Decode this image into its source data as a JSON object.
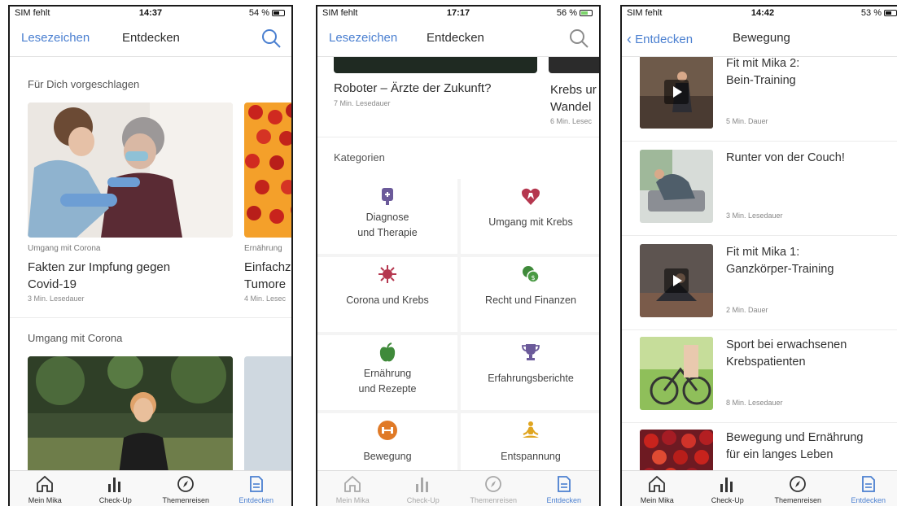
{
  "screen1": {
    "status": {
      "carrier": "SIM fehlt",
      "time": "14:37",
      "battery": "54 %"
    },
    "nav": {
      "left": "Lesezeichen",
      "title": "Entdecken"
    },
    "section1": "Für Dich vorgeschlagen",
    "card1": {
      "category": "Umgang mit Corona",
      "title": "Fakten zur Impfung gegen\nCovid-19",
      "meta": "3 Min. Lesedauer"
    },
    "card2": {
      "category": "Ernährung",
      "title": "Einfachz\nTumore",
      "meta": "4 Min. Lesec"
    },
    "section2": "Umgang mit Corona"
  },
  "screen2": {
    "status": {
      "carrier": "SIM fehlt",
      "time": "17:17",
      "battery": "56 %"
    },
    "nav": {
      "left": "Lesezeichen",
      "title": "Entdecken"
    },
    "card1": {
      "title": "Roboter – Ärzte der Zukunft?",
      "meta": "7 Min. Lesedauer"
    },
    "card2": {
      "title": "Krebs ur\nWandel",
      "meta": "6 Min. Lesec"
    },
    "categories_heading": "Kategorien",
    "categories": [
      {
        "label": "Diagnose\nund Therapie",
        "icon": "iv-bag-icon"
      },
      {
        "label": "Umgang mit Krebs",
        "icon": "ribbon-heart-icon"
      },
      {
        "label": "Corona und Krebs",
        "icon": "virus-icon"
      },
      {
        "label": "Recht und Finanzen",
        "icon": "coins-icon"
      },
      {
        "label": "Ernährung\nund Rezepte",
        "icon": "apple-icon"
      },
      {
        "label": "Erfahrungsberichte",
        "icon": "trophy-icon"
      },
      {
        "label": "Bewegung",
        "icon": "dumbbell-icon"
      },
      {
        "label": "Entspannung",
        "icon": "meditation-icon"
      }
    ]
  },
  "screen3": {
    "status": {
      "carrier": "SIM fehlt",
      "time": "14:42",
      "battery": "53 %"
    },
    "nav": {
      "back": "Entdecken",
      "title": "Bewegung"
    },
    "items": [
      {
        "title": "Fit mit Mika 2:\nBein-Training",
        "meta": "5 Min. Dauer",
        "video": true
      },
      {
        "title": "Runter von der Couch!",
        "meta": "3 Min. Lesedauer",
        "video": false
      },
      {
        "title": "Fit mit Mika 1:\nGanzkörper-Training",
        "meta": "2 Min. Dauer",
        "video": true
      },
      {
        "title": "Sport bei erwachsenen\nKrebspatienten",
        "meta": "8 Min. Lesedauer",
        "video": false
      },
      {
        "title": "Bewegung und Ernährung\nfür ein langes Leben",
        "meta": "",
        "video": false
      }
    ]
  },
  "tabs": [
    "Mein Mika",
    "Check-Up",
    "Themenreisen",
    "Entdecken"
  ],
  "colors": {
    "accent": "#4a7fd0",
    "category_red": "#b5374f",
    "category_green": "#3f8a3a",
    "category_orange": "#e07a27",
    "category_purple": "#6b5a9a"
  }
}
